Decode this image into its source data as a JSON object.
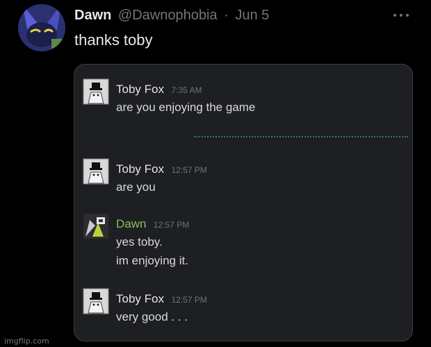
{
  "tweet": {
    "author_name": "Dawn",
    "handle": "@Dawnophobia",
    "separator": "·",
    "date": "Jun 5",
    "text": "thanks toby",
    "more_icon": "more-horizontal-icon"
  },
  "chat": {
    "messages": [
      {
        "author": "Toby Fox",
        "time": "7:35 AM",
        "lines": [
          "are you enjoying the game"
        ],
        "author_color": "#e6e6e6"
      },
      {
        "author": "Toby Fox",
        "time": "12:57 PM",
        "lines": [
          "are you"
        ],
        "author_color": "#e6e6e6"
      },
      {
        "author": "Dawn",
        "time": "12:57 PM",
        "lines": [
          "yes toby.",
          "im enjoying it."
        ],
        "author_color": "#8cc05a"
      },
      {
        "author": "Toby Fox",
        "time": "12:57 PM",
        "lines": [
          "very good . . ."
        ],
        "author_color": "#e6e6e6"
      }
    ],
    "unread_divider_color": "#2f7a5f"
  },
  "watermark": "imgflip.com",
  "colors": {
    "background": "#000000",
    "chat_background": "#1e1f22",
    "muted_text": "#71767b"
  }
}
